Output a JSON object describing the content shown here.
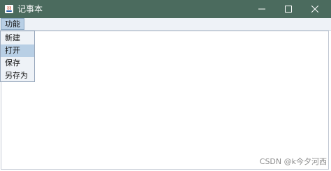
{
  "window": {
    "title": "记事本",
    "titlebar_color": "#4b6b5e"
  },
  "menubar": {
    "function_menu_label": "功能"
  },
  "dropdown": {
    "items": [
      {
        "label": "新建",
        "highlighted": false
      },
      {
        "label": "打开",
        "highlighted": true
      },
      {
        "label": "保存",
        "highlighted": false
      },
      {
        "label": "另存为",
        "highlighted": false
      }
    ],
    "highlight_color": "#b8cfe5"
  },
  "editor": {
    "content": ""
  },
  "watermark": {
    "text": "CSDN @k今夕河西"
  }
}
